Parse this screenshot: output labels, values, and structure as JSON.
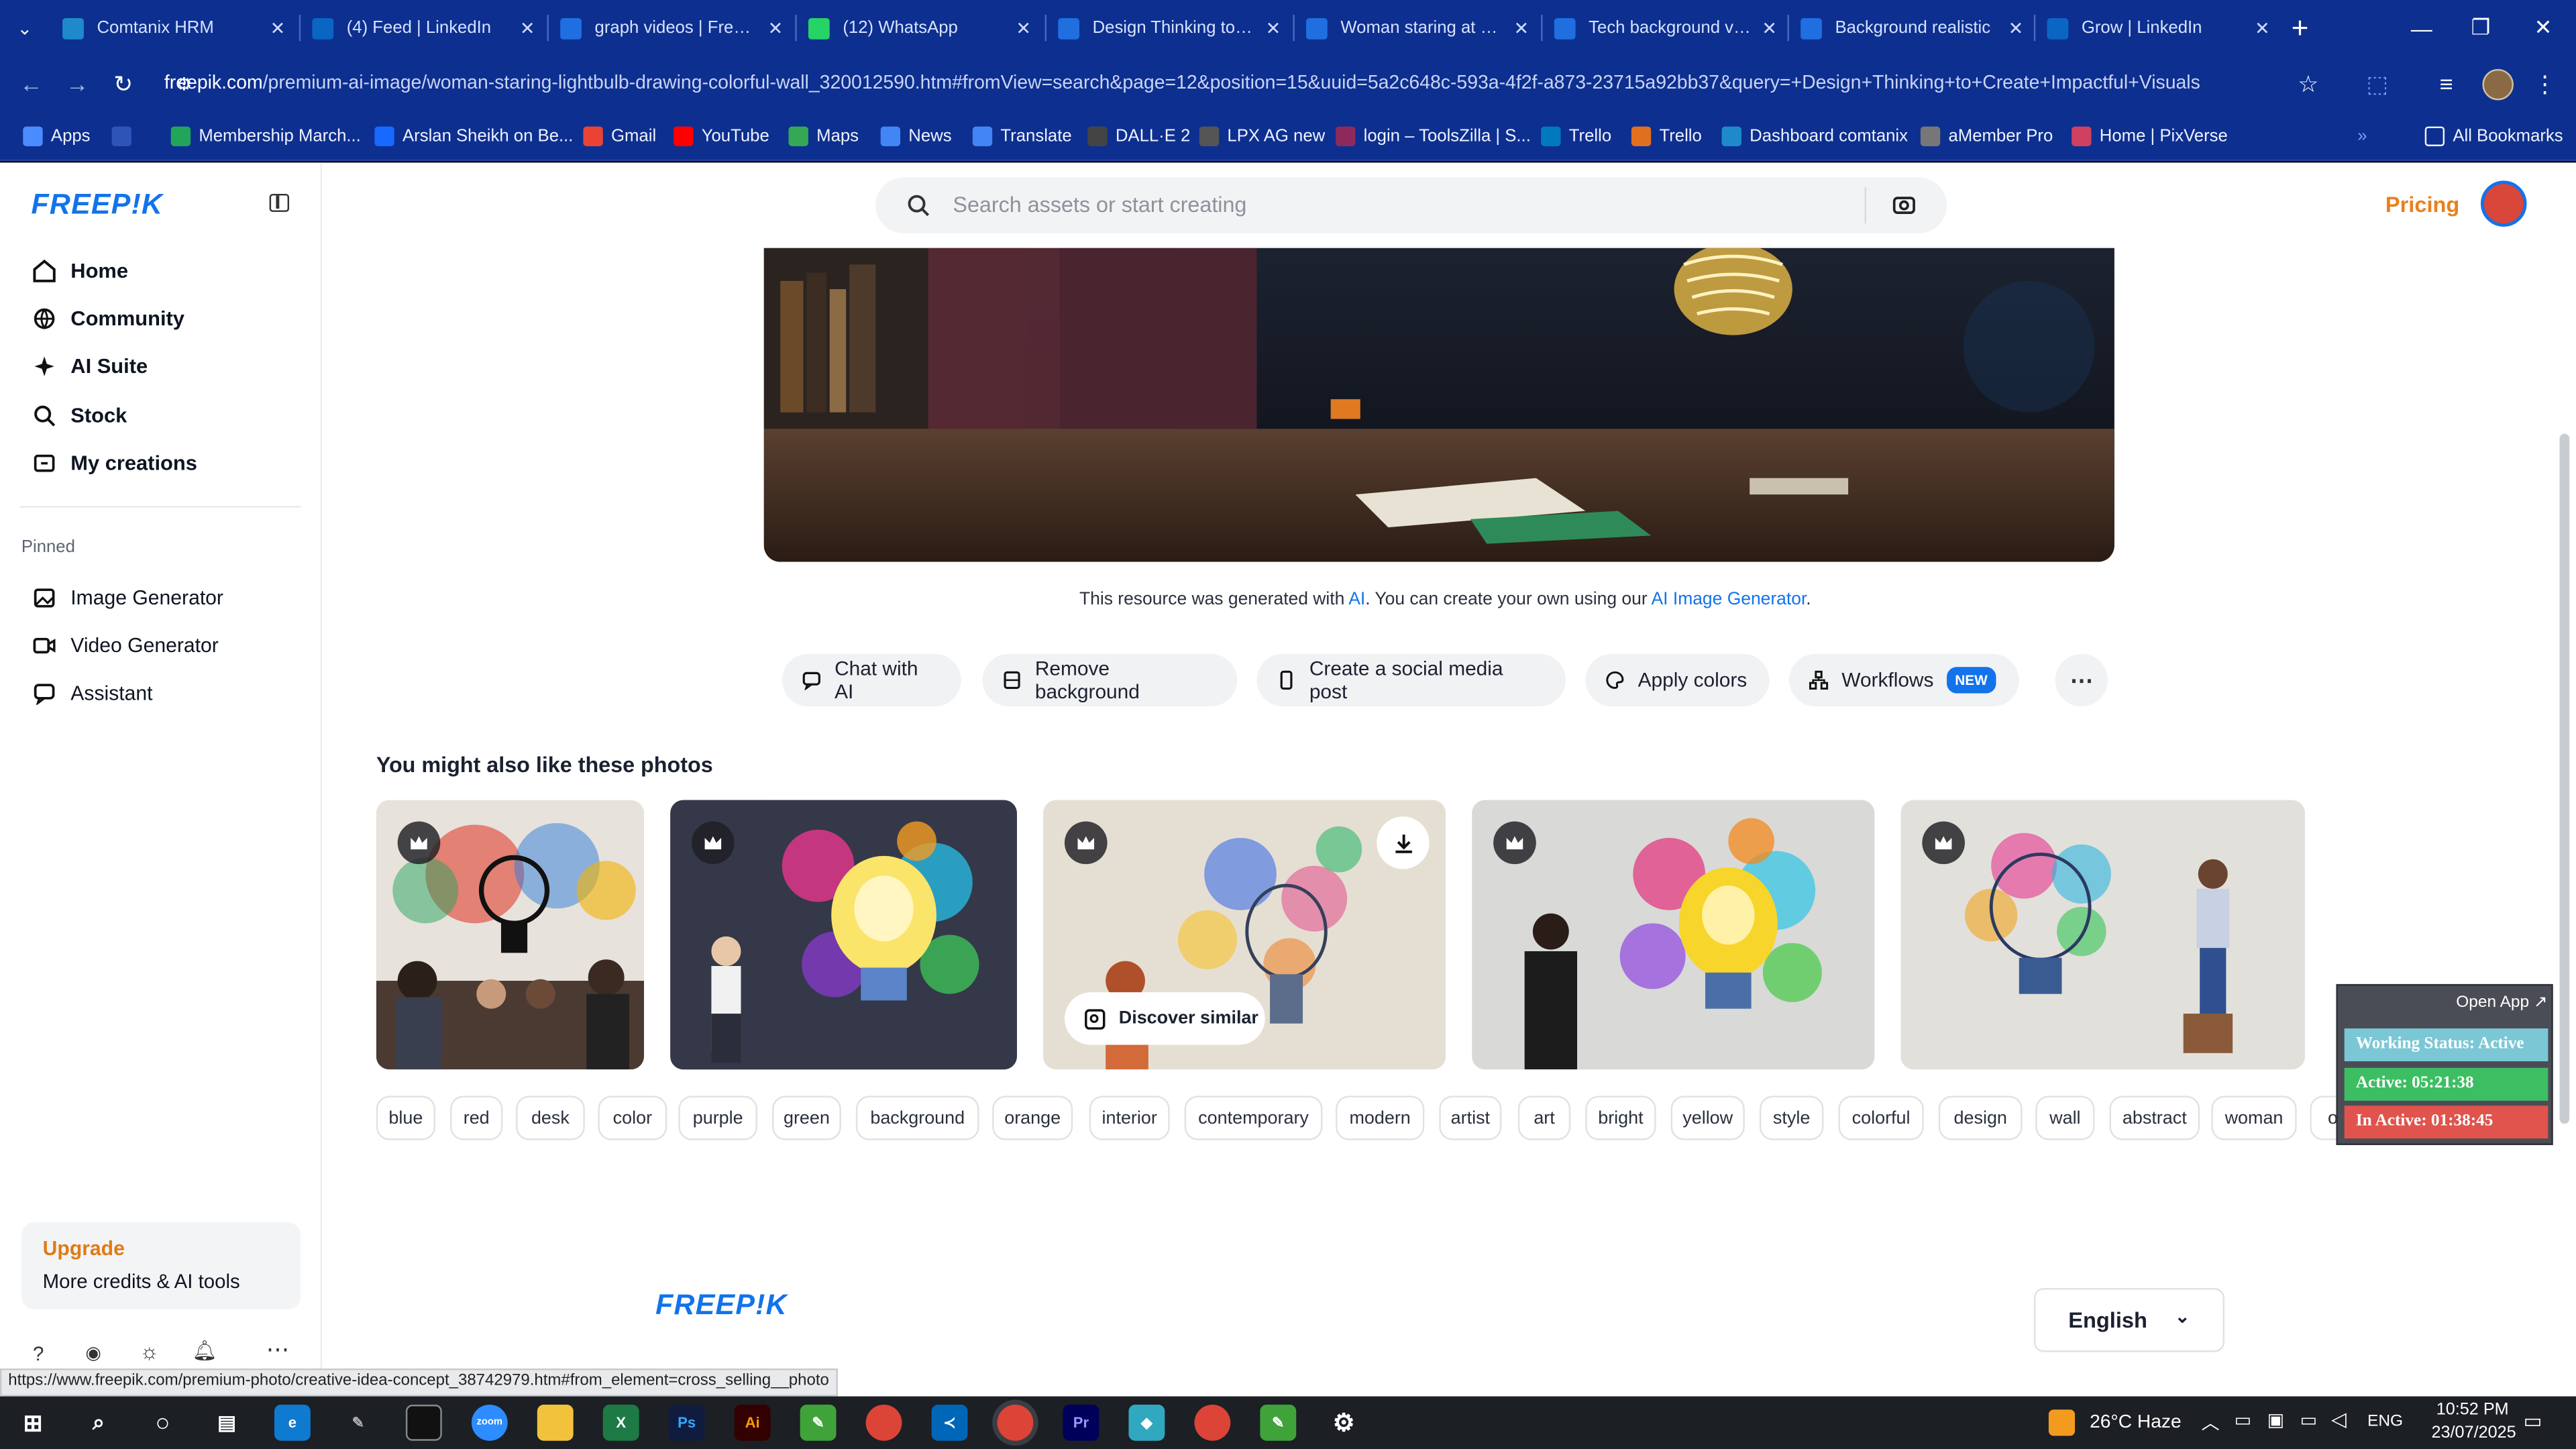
{
  "browser": {
    "tabs": [
      {
        "title": "Comtanix HRM",
        "icon": "comtanix-icon",
        "color": "#1f8acb"
      },
      {
        "title": "(4) Feed | LinkedIn",
        "icon": "linkedin-icon",
        "color": "#0a66c2"
      },
      {
        "title": "graph videos | Freepik",
        "icon": "freepik-icon",
        "color": "#1f6fe0"
      },
      {
        "title": "(12) WhatsApp",
        "icon": "whatsapp-icon",
        "color": "#25d366"
      },
      {
        "title": "Design Thinking to Cre",
        "icon": "freepik-icon",
        "color": "#1f6fe0"
      },
      {
        "title": "Woman staring at a lig",
        "icon": "freepik-icon",
        "color": "#1f6fe0"
      },
      {
        "title": "Tech background vec",
        "icon": "freepik-icon",
        "color": "#1f6fe0"
      },
      {
        "title": "Background realistic",
        "icon": "freepik-icon",
        "color": "#1f6fe0"
      },
      {
        "title": "Grow | LinkedIn",
        "icon": "linkedin-icon",
        "color": "#0a66c2"
      }
    ],
    "url_host": "freepik.com",
    "url_rest": "/premium-ai-image/woman-staring-lightbulb-drawing-colorful-wall_320012590.htm#fromView=search&page=12&position=15&uuid=5a2c648c-593a-4f2f-a873-23715a92bb37&query=+Design+Thinking+to+Create+Impactful+Visuals",
    "bookmarks": [
      {
        "label": "Apps",
        "icon": "apps-icon",
        "color": "#4a8cff"
      },
      {
        "label": "Membership March...",
        "icon": "bookmark-icon",
        "color": "#22a55b"
      },
      {
        "label": "Arslan Sheikh on Be...",
        "icon": "behance-icon",
        "color": "#1769ff"
      },
      {
        "label": "Gmail",
        "icon": "gmail-icon",
        "color": "#ea4335"
      },
      {
        "label": "YouTube",
        "icon": "youtube-icon",
        "color": "#ff0000"
      },
      {
        "label": "Maps",
        "icon": "maps-icon",
        "color": "#34a853"
      },
      {
        "label": "News",
        "icon": "news-icon",
        "color": "#4285f4"
      },
      {
        "label": "Translate",
        "icon": "translate-icon",
        "color": "#4285f4"
      },
      {
        "label": "DALL·E 2",
        "icon": "openai-icon",
        "color": "#444444"
      },
      {
        "label": "LPX AG new",
        "icon": "bookmark-icon",
        "color": "#555555"
      },
      {
        "label": "login – ToolsZilla | S...",
        "icon": "bookmark-icon",
        "color": "#8e2a5b"
      },
      {
        "label": "Trello",
        "icon": "trello-icon",
        "color": "#0079bf"
      },
      {
        "label": "Trello",
        "icon": "trello-icon",
        "color": "#e06f1f"
      },
      {
        "label": "Dashboard comtanix",
        "icon": "comtanix-icon",
        "color": "#1f8acb"
      },
      {
        "label": "aMember Pro",
        "icon": "bookmark-icon",
        "color": "#777777"
      },
      {
        "label": "Home | PixVerse",
        "icon": "pixverse-icon",
        "color": "#d04060"
      }
    ],
    "all_bookmarks": "All Bookmarks"
  },
  "sidebar": {
    "brand": "FREEP!K",
    "nav": [
      {
        "label": "Home",
        "icon": "home-icon"
      },
      {
        "label": "Community",
        "icon": "globe-icon"
      },
      {
        "label": "AI Suite",
        "icon": "sparkle-icon"
      },
      {
        "label": "Stock",
        "icon": "search-icon"
      },
      {
        "label": "My creations",
        "icon": "folder-icon"
      }
    ],
    "pinned_title": "Pinned",
    "pinned": [
      {
        "label": "Image Generator",
        "icon": "image-icon"
      },
      {
        "label": "Video Generator",
        "icon": "video-icon"
      },
      {
        "label": "Assistant",
        "icon": "chat-icon"
      }
    ],
    "upgrade_title": "Upgrade",
    "upgrade_text": "More credits & AI tools"
  },
  "header": {
    "search_placeholder": "Search assets or start creating",
    "pricing": "Pricing"
  },
  "resource": {
    "note_pre": "This resource was generated with",
    "note_ai": "AI",
    "note_mid": ". You can create your own using our",
    "note_link": "AI Image Generator",
    "note_end": "."
  },
  "actions": [
    {
      "label": "Chat with AI",
      "icon": "chat-icon"
    },
    {
      "label": "Remove background",
      "icon": "remove-bg-icon"
    },
    {
      "label": "Create a social media post",
      "icon": "phone-icon"
    },
    {
      "label": "Apply colors",
      "icon": "palette-icon"
    },
    {
      "label": "Workflows",
      "icon": "workflow-icon",
      "badge": "NEW"
    }
  ],
  "related": {
    "heading": "You might also like these photos",
    "discover": "Discover similar"
  },
  "tags": [
    "blue",
    "red",
    "desk",
    "color",
    "purple",
    "green",
    "background",
    "orange",
    "interior",
    "contemporary",
    "modern",
    "artist",
    "art",
    "bright",
    "yellow",
    "style",
    "colorful",
    "design",
    "wall",
    "abstract",
    "woman",
    "ot"
  ],
  "footer": {
    "brand": "FREEP!K",
    "language": "English"
  },
  "status_url": "https://www.freepik.com/premium-photo/creative-idea-concept_38742979.htm#from_element=cross_selling__photo",
  "widget": {
    "open_app": "Open App ↗",
    "working_status": "Working Status: Active",
    "active": "Active: 05:21:38",
    "inactive": "In Active: 01:38:45"
  },
  "taskbar": {
    "weather": "26°C  Haze",
    "lang": "ENG",
    "time": "10:52 PM",
    "date": "23/07/2025"
  },
  "colors": {
    "brand_blue": "#1273eb",
    "pricing_orange": "#e8811c",
    "browser_blue": "#0d2f8f"
  }
}
